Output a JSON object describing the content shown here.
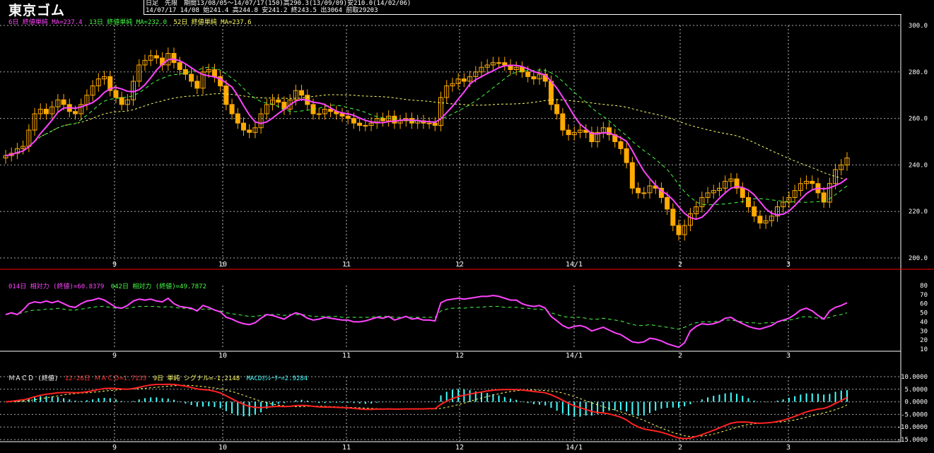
{
  "header": {
    "title": "東京ゴム",
    "line1": "日足　先限　期間13/08/05～14/07/17(150)高290.3(13/09/09)安210.0(14/02/06)",
    "line2": "14/07/17 14/08 始241.4 高244.8 安241.2 終243.5 出3064 前取29203"
  },
  "price_legend": [
    {
      "text": "6日 終値単純 MA=237.4",
      "color": "#ff44ff"
    },
    {
      "text": "13日 終値単純 MA=232.0",
      "color": "#44ff44"
    },
    {
      "text": "52日 終値単純 MA=237.6",
      "color": "#ffff66"
    }
  ],
  "rsi_legend": [
    {
      "text": "014日 相対力 (終値)=60.8379",
      "color": "#ff44ff"
    },
    {
      "text": "042日 相対力 (終値)=49.7872",
      "color": "#44ff44"
    }
  ],
  "macd_legend": [
    {
      "text": "ＭＡＣＤ (終値)",
      "color": "#ffffff"
    },
    {
      "text": "12-26日 ＭＡＣＤ=1.7135",
      "color": "#ff3333"
    },
    {
      "text": "9日 単純 シグナル=-1.2148",
      "color": "#ffff66"
    },
    {
      "text": "MACDｵｼﾚｰﾀｰ=2.9284",
      "color": "#44ffff"
    }
  ],
  "colors": {
    "candle_up": "#ffaa00",
    "ma6": "#ff44ff",
    "ma13": "#44ff44",
    "ma52": "#ffff66",
    "macd": "#ff2222",
    "signal": "#ffff66",
    "oscillator": "#44ffff",
    "frame": "#ffffff",
    "separator": "#ff0000"
  },
  "chart_data": [
    {
      "type": "candlestick",
      "title": "東京ゴム",
      "ylim": [
        200,
        300
      ],
      "yticks": [
        "200.0",
        "220.0",
        "240.0",
        "260.0",
        "280.0",
        "300.0"
      ],
      "x_labels": [
        "9",
        "10",
        "11",
        "12",
        "14/1",
        "2",
        "3"
      ],
      "grid": true,
      "close_series": [
        244,
        245,
        247,
        248,
        255,
        262,
        264,
        262,
        265,
        268,
        266,
        263,
        262,
        266,
        270,
        274,
        277,
        278,
        272,
        269,
        266,
        268,
        276,
        283,
        285,
        287,
        286,
        283,
        288,
        284,
        281,
        279,
        276,
        273,
        280,
        281,
        278,
        274,
        266,
        262,
        258,
        255,
        254,
        256,
        262,
        266,
        268,
        267,
        264,
        268,
        272,
        270,
        266,
        262,
        262,
        264,
        263,
        262,
        261,
        260,
        258,
        257,
        257,
        258,
        260,
        259,
        261,
        258,
        259,
        260,
        258,
        259,
        258,
        258,
        257,
        269,
        274,
        275,
        277,
        276,
        278,
        280,
        282,
        283,
        284,
        284,
        283,
        281,
        282,
        280,
        278,
        277,
        279,
        276,
        266,
        262,
        255,
        253,
        254,
        255,
        254,
        250,
        254,
        256,
        253,
        250,
        247,
        241,
        230,
        228,
        228,
        231,
        230,
        226,
        221,
        214,
        210,
        214,
        219,
        222,
        226,
        228,
        229,
        230,
        233,
        234,
        230,
        226,
        222,
        218,
        215,
        216,
        218,
        222,
        224,
        226,
        229,
        232,
        233,
        232,
        228,
        224,
        232,
        238,
        240,
        243
      ]
    },
    {
      "type": "line",
      "title": "相対力",
      "ylim": [
        10,
        80
      ],
      "yticks": [
        "10",
        "20",
        "30",
        "40",
        "50",
        "60",
        "70",
        "80"
      ],
      "series": [
        {
          "name": "014日 相対力 (終値)",
          "values": [
            48,
            50,
            48,
            53,
            60,
            62,
            61,
            63,
            61,
            63,
            60,
            57,
            56,
            60,
            63,
            64,
            66,
            64,
            60,
            56,
            55,
            58,
            63,
            65,
            64,
            65,
            63,
            62,
            66,
            60,
            57,
            56,
            55,
            52,
            58,
            56,
            53,
            51,
            45,
            43,
            40,
            38,
            37,
            39,
            44,
            48,
            47,
            45,
            43,
            47,
            50,
            48,
            44,
            42,
            43,
            45,
            44,
            43,
            42,
            42,
            40,
            40,
            41,
            43,
            45,
            44,
            46,
            42,
            44,
            46,
            43,
            44,
            42,
            42,
            41,
            61,
            64,
            65,
            66,
            65,
            66,
            67,
            68,
            68,
            69,
            68,
            66,
            64,
            64,
            60,
            58,
            57,
            58,
            55,
            46,
            41,
            36,
            33,
            35,
            36,
            34,
            30,
            32,
            34,
            31,
            28,
            26,
            22,
            18,
            17,
            18,
            22,
            21,
            19,
            16,
            14,
            12,
            17,
            30,
            35,
            38,
            37,
            38,
            40,
            44,
            45,
            41,
            38,
            35,
            33,
            32,
            34,
            36,
            40,
            42,
            44,
            48,
            53,
            55,
            52,
            47,
            43,
            52,
            56,
            58,
            61
          ]
        },
        {
          "name": "042日 相対力 (終値)",
          "values": [
            48,
            49,
            49,
            50,
            52,
            53,
            53,
            54,
            54,
            55,
            54,
            53,
            53,
            54,
            55,
            56,
            57,
            57,
            56,
            55,
            55,
            55,
            56,
            57,
            57,
            57,
            57,
            56,
            57,
            56,
            55,
            55,
            54,
            53,
            54,
            54,
            53,
            52,
            50,
            49,
            48,
            47,
            46,
            46,
            47,
            48,
            48,
            48,
            47,
            48,
            48,
            48,
            47,
            46,
            46,
            46,
            46,
            46,
            45,
            45,
            45,
            45,
            45,
            45,
            46,
            46,
            46,
            45,
            45,
            46,
            45,
            45,
            45,
            45,
            45,
            52,
            54,
            55,
            55,
            55,
            56,
            56,
            56,
            57,
            57,
            57,
            56,
            56,
            56,
            55,
            55,
            54,
            54,
            53,
            50,
            48,
            46,
            45,
            45,
            45,
            44,
            43,
            43,
            44,
            43,
            42,
            41,
            39,
            37,
            36,
            36,
            37,
            36,
            35,
            34,
            33,
            32,
            34,
            37,
            39,
            40,
            40,
            40,
            41,
            42,
            42,
            41,
            40,
            39,
            39,
            38,
            39,
            39,
            40,
            41,
            42,
            43,
            45,
            46,
            45,
            44,
            43,
            45,
            47,
            48,
            50
          ]
        }
      ]
    },
    {
      "type": "line",
      "title": "ＭＡＣＤ (終値)",
      "ylim": [
        -15,
        10
      ],
      "yticks": [
        "10.0000",
        "5.0000",
        "0.0000",
        "-5.0000",
        "-10.0000",
        "-15.0000"
      ],
      "series": [
        {
          "name": "12-26日 ＭＡＣＤ",
          "values": [
            0,
            0.2,
            0.5,
            0.8,
            1.3,
            2,
            2.6,
            3,
            3.3,
            3.6,
            3.7,
            3.7,
            3.6,
            3.7,
            4,
            4.4,
            4.9,
            5.3,
            5.4,
            5.3,
            5.1,
            5,
            5.3,
            5.8,
            6.3,
            6.7,
            6.9,
            6.9,
            7,
            6.9,
            6.6,
            6.2,
            5.7,
            5.1,
            4.9,
            4.7,
            4.2,
            3.5,
            2.4,
            1.2,
            0,
            -1,
            -1.8,
            -2.2,
            -2.3,
            -2.1,
            -1.9,
            -1.8,
            -1.9,
            -1.8,
            -1.5,
            -1.4,
            -1.5,
            -1.8,
            -2,
            -2.1,
            -2.1,
            -2.2,
            -2.3,
            -2.4,
            -2.6,
            -2.8,
            -3,
            -3,
            -2.9,
            -2.9,
            -2.8,
            -2.9,
            -2.9,
            -2.8,
            -2.8,
            -2.8,
            -2.8,
            -2.7,
            -2.7,
            -1,
            0.3,
            1.3,
            2.1,
            2.6,
            3.1,
            3.5,
            3.9,
            4.3,
            4.6,
            4.8,
            4.9,
            4.9,
            4.9,
            4.7,
            4.4,
            4.1,
            3.9,
            3.6,
            2.8,
            1.8,
            0.6,
            -0.6,
            -1.6,
            -2.4,
            -3,
            -3.8,
            -4.2,
            -4.4,
            -4.8,
            -5.4,
            -6.1,
            -7.2,
            -8.8,
            -10,
            -10.8,
            -11.2,
            -11.6,
            -12.1,
            -12.8,
            -13.6,
            -14.4,
            -14.6,
            -14.4,
            -13.8,
            -13,
            -12.2,
            -11.3,
            -10.4,
            -9.4,
            -8.5,
            -8.1,
            -8,
            -8.1,
            -8.4,
            -8.5,
            -8.4,
            -8.2,
            -7.8,
            -7.3,
            -6.6,
            -5.8,
            -4.9,
            -4,
            -3.4,
            -2.9,
            -2.6,
            -1.8,
            -0.6,
            0.5,
            1.7
          ]
        },
        {
          "name": "9日 単純 シグナル",
          "values": [
            0,
            0,
            0.1,
            0.3,
            0.5,
            0.8,
            1.2,
            1.6,
            2,
            2.4,
            2.8,
            3.1,
            3.3,
            3.5,
            3.6,
            3.8,
            4,
            4.3,
            4.5,
            4.7,
            4.9,
            5,
            5.1,
            5.2,
            5.4,
            5.6,
            5.8,
            6,
            6.2,
            6.4,
            6.5,
            6.6,
            6.5,
            6.3,
            6.1,
            5.8,
            5.5,
            5.1,
            4.7,
            4.1,
            3.4,
            2.6,
            1.8,
            1,
            0.3,
            -0.4,
            -0.9,
            -1.3,
            -1.6,
            -1.8,
            -1.9,
            -1.9,
            -1.8,
            -1.7,
            -1.7,
            -1.8,
            -1.9,
            -2,
            -2.1,
            -2.2,
            -2.3,
            -2.4,
            -2.5,
            -2.6,
            -2.7,
            -2.8,
            -2.8,
            -2.8,
            -2.8,
            -2.8,
            -2.8,
            -2.8,
            -2.8,
            -2.8,
            -2.8,
            -2.6,
            -2.2,
            -1.7,
            -1.1,
            -0.5,
            0.2,
            0.9,
            1.5,
            2.1,
            2.7,
            3.2,
            3.7,
            4.1,
            4.4,
            4.6,
            4.7,
            4.7,
            4.6,
            4.5,
            4.3,
            4,
            3.5,
            2.8,
            2.1,
            1.3,
            0.4,
            -0.4,
            -1.2,
            -1.9,
            -2.6,
            -3.3,
            -4,
            -4.8,
            -5.6,
            -6.5,
            -7.4,
            -8.4,
            -9.4,
            -10.4,
            -11.3,
            -12.2,
            -12.9,
            -13.5,
            -13.8,
            -13.8,
            -13.6,
            -13.3,
            -12.8,
            -12.2,
            -11.5,
            -10.8,
            -10.1,
            -9.5,
            -9,
            -8.7,
            -8.5,
            -8.3,
            -8.2,
            -8.1,
            -7.9,
            -7.6,
            -7.2,
            -6.7,
            -6.1,
            -5.5,
            -4.9,
            -4.4,
            -3.8,
            -3.1,
            -2.3,
            -1.2
          ]
        }
      ]
    }
  ]
}
